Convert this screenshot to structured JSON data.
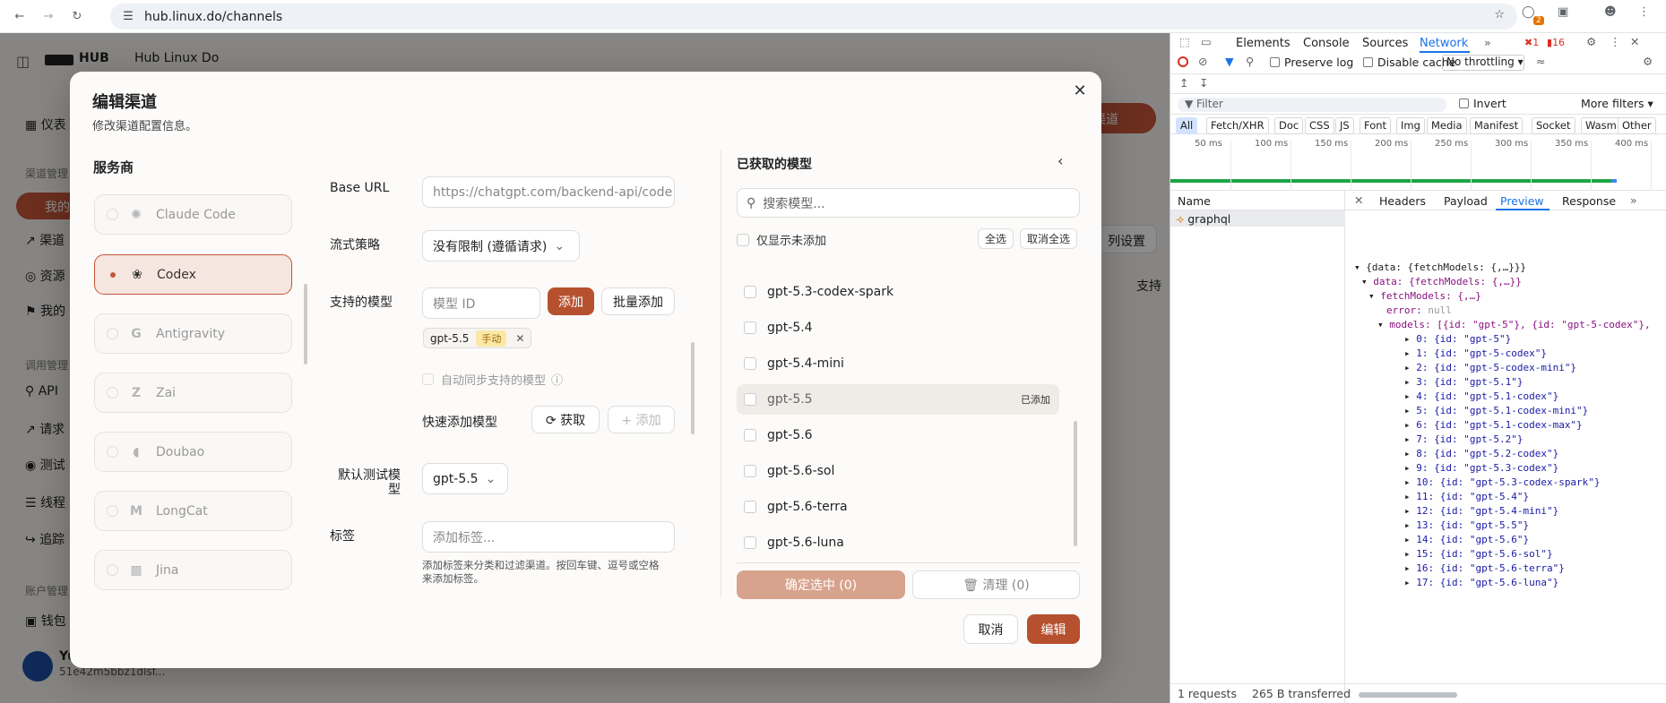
{
  "browser": {
    "url": "hub.linux.do/channels",
    "ext_badge": "2"
  },
  "app": {
    "brand": "HUB",
    "workspace": "Hub Linux Do",
    "sidebar": {
      "home_label": "仪表",
      "group1": "渠道管理",
      "mine_label": "我的",
      "channels_label": "渠道",
      "resources_label": "资源",
      "my2_label": "我的",
      "group2": "调用管理",
      "api_label": "API",
      "requests_label": "请求",
      "test_label": "测试",
      "threads_label": "线程",
      "trace_label": "追踪",
      "group3": "账户管理",
      "wallet_label": "钱包",
      "user_initial": "Yu",
      "user_id": "51e42m5bbz1dlsf..."
    },
    "bg_button": "渠道",
    "bg_colset": "列设置",
    "bg_col": "支持"
  },
  "dialog": {
    "title": "编辑渠道",
    "subtitle": "修改渠道配置信息。",
    "provider_heading": "服务商",
    "providers": [
      "Claude Code",
      "Codex",
      "Antigravity",
      "Zai",
      "Doubao",
      "LongCat",
      "Jina"
    ],
    "base_url_label": "Base URL",
    "base_url_placeholder": "https://chatgpt.com/backend-api/code",
    "stream_label": "流式策略",
    "stream_value": "没有限制 (遵循请求)",
    "models_label": "支持的模型",
    "model_id_placeholder": "模型 ID",
    "add_label": "添加",
    "bulk_add_label": "批量添加",
    "chip_model": "gpt-5.5",
    "chip_badge": "手动",
    "autosync_label": "自动同步支持的模型",
    "quick_add_label": "快速添加模型",
    "fetch_label": "获取",
    "quick_add_btn": "+ 添加",
    "default_test_label": "默认测试模型",
    "default_test_value": "gpt-5.5",
    "tags_label": "标签",
    "tags_placeholder": "添加标签...",
    "tags_hint": "添加标签来分类和过滤渠道。按回车键、逗号或空格来添加标签。",
    "cancel_label": "取消",
    "edit_label": "编辑"
  },
  "fetched": {
    "title": "已获取的模型",
    "search_placeholder": "搜索模型...",
    "only_new_label": "仅显示未添加",
    "select_all": "全选",
    "deselect_all": "取消全选",
    "models": [
      {
        "name": "gpt-5.3-codex-spark",
        "added": false
      },
      {
        "name": "gpt-5.4",
        "added": false
      },
      {
        "name": "gpt-5.4-mini",
        "added": false
      },
      {
        "name": "gpt-5.5",
        "added": true
      },
      {
        "name": "gpt-5.6",
        "added": false
      },
      {
        "name": "gpt-5.6-sol",
        "added": false
      },
      {
        "name": "gpt-5.6-terra",
        "added": false
      },
      {
        "name": "gpt-5.6-luna",
        "added": false
      }
    ],
    "added_tag": "已添加",
    "confirm_label": "确定选中 (0)",
    "clear_label": "清理 (0)"
  },
  "devtools": {
    "tabs": [
      "Elements",
      "Console",
      "Sources",
      "Network"
    ],
    "errors": "1",
    "warnings": "16",
    "preserve_log": "Preserve log",
    "disable_cache": "Disable cache",
    "throttling": "No throttling",
    "filter_placeholder": "Filter",
    "invert": "Invert",
    "more_filters": "More filters",
    "type_filters": [
      "All",
      "Fetch/XHR",
      "Doc",
      "CSS",
      "JS",
      "Font",
      "Img",
      "Media",
      "Manifest",
      "Socket",
      "Wasm",
      "Other"
    ],
    "timeline_labels": [
      "50 ms",
      "100 ms",
      "150 ms",
      "200 ms",
      "250 ms",
      "300 ms",
      "350 ms",
      "400 ms"
    ],
    "name_col": "Name",
    "request_name": "graphql",
    "detail_tabs": [
      "Headers",
      "Payload",
      "Preview",
      "Response"
    ],
    "json_root": "{data: {fetchModels: {,…}}}",
    "json_data": "data: {fetchModels: {,…}}",
    "json_fetch": "fetchModels: {,…}",
    "json_error_key": "error:",
    "json_error_val": "null",
    "json_models": "models: [{id: \"gpt-5\"}, {id: \"gpt-5-codex\"},",
    "json_items": [
      "0: {id: \"gpt-5\"}",
      "1: {id: \"gpt-5-codex\"}",
      "2: {id: \"gpt-5-codex-mini\"}",
      "3: {id: \"gpt-5.1\"}",
      "4: {id: \"gpt-5.1-codex\"}",
      "5: {id: \"gpt-5.1-codex-mini\"}",
      "6: {id: \"gpt-5.1-codex-max\"}",
      "7: {id: \"gpt-5.2\"}",
      "8: {id: \"gpt-5.2-codex\"}",
      "9: {id: \"gpt-5.3-codex\"}",
      "10: {id: \"gpt-5.3-codex-spark\"}",
      "11: {id: \"gpt-5.4\"}",
      "12: {id: \"gpt-5.4-mini\"}",
      "13: {id: \"gpt-5.5\"}",
      "14: {id: \"gpt-5.6\"}",
      "15: {id: \"gpt-5.6-sol\"}",
      "16: {id: \"gpt-5.6-terra\"}",
      "17: {id: \"gpt-5.6-luna\"}"
    ],
    "status_requests": "1 requests",
    "status_transferred": "265 B transferred"
  }
}
